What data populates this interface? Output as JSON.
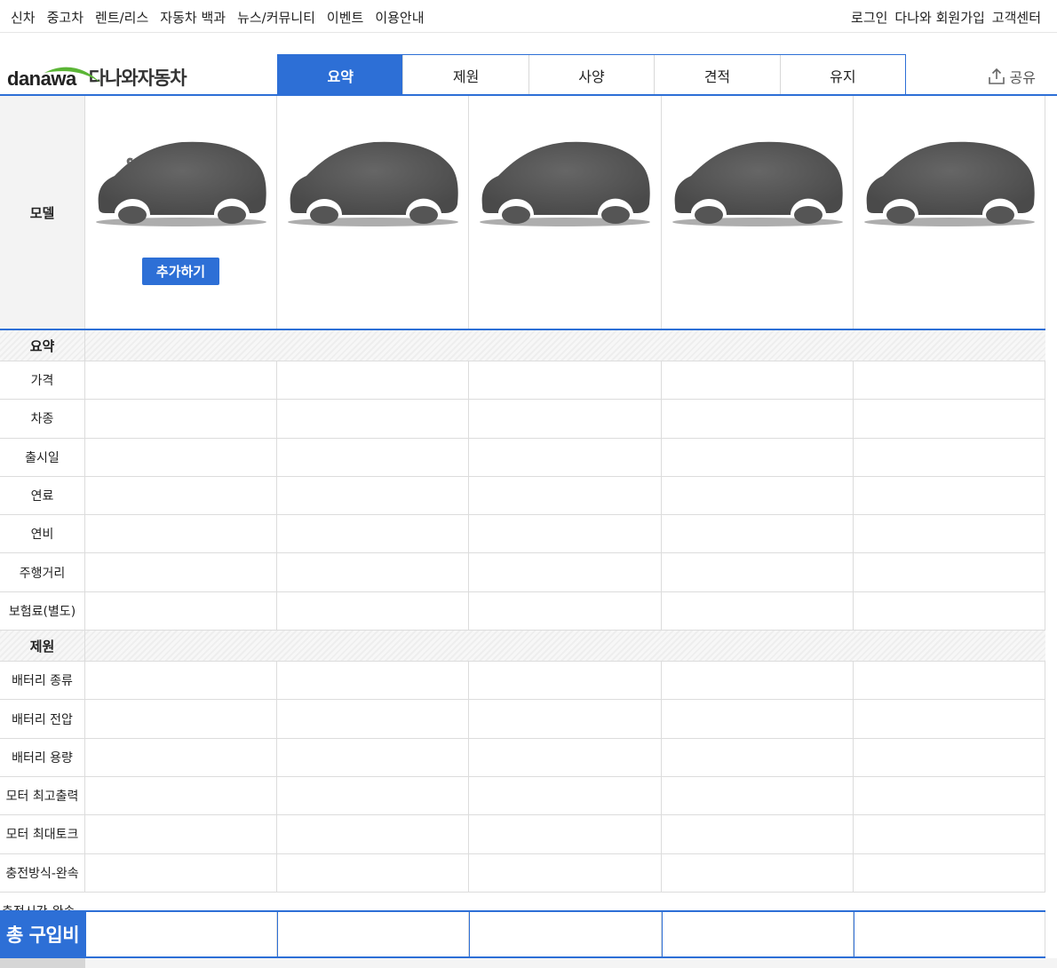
{
  "topnav": {
    "left": [
      "신차",
      "중고차",
      "렌트/리스",
      "자동차 백과",
      "뉴스/커뮤니티",
      "이벤트",
      "이용안내"
    ],
    "right": [
      "로그인",
      "다나와 회원가입",
      "고객센터"
    ]
  },
  "logo": {
    "en": "danawa",
    "kr": "다나와자동차"
  },
  "tabs": [
    "요약",
    "제원",
    "사양",
    "견적",
    "유지"
  ],
  "share_label": "공유",
  "model": {
    "label": "모델",
    "add_button": "추가하기"
  },
  "sections": [
    {
      "title": "요약",
      "rows": [
        "가격",
        "차종",
        "출시일",
        "연료",
        "연비",
        "주행거리",
        "보험료(별도)"
      ]
    },
    {
      "title": "제원",
      "rows": [
        "배터리 종류",
        "배터리 전압",
        "배터리 용량",
        "모터 최고출력",
        "모터 최대토크",
        "충전방식-완속"
      ]
    }
  ],
  "cutoff_row": "충전시간-완속",
  "footer": {
    "total_label": "총 구입비"
  },
  "colors": {
    "accent": "#2d6fd6",
    "car": "#555555"
  }
}
